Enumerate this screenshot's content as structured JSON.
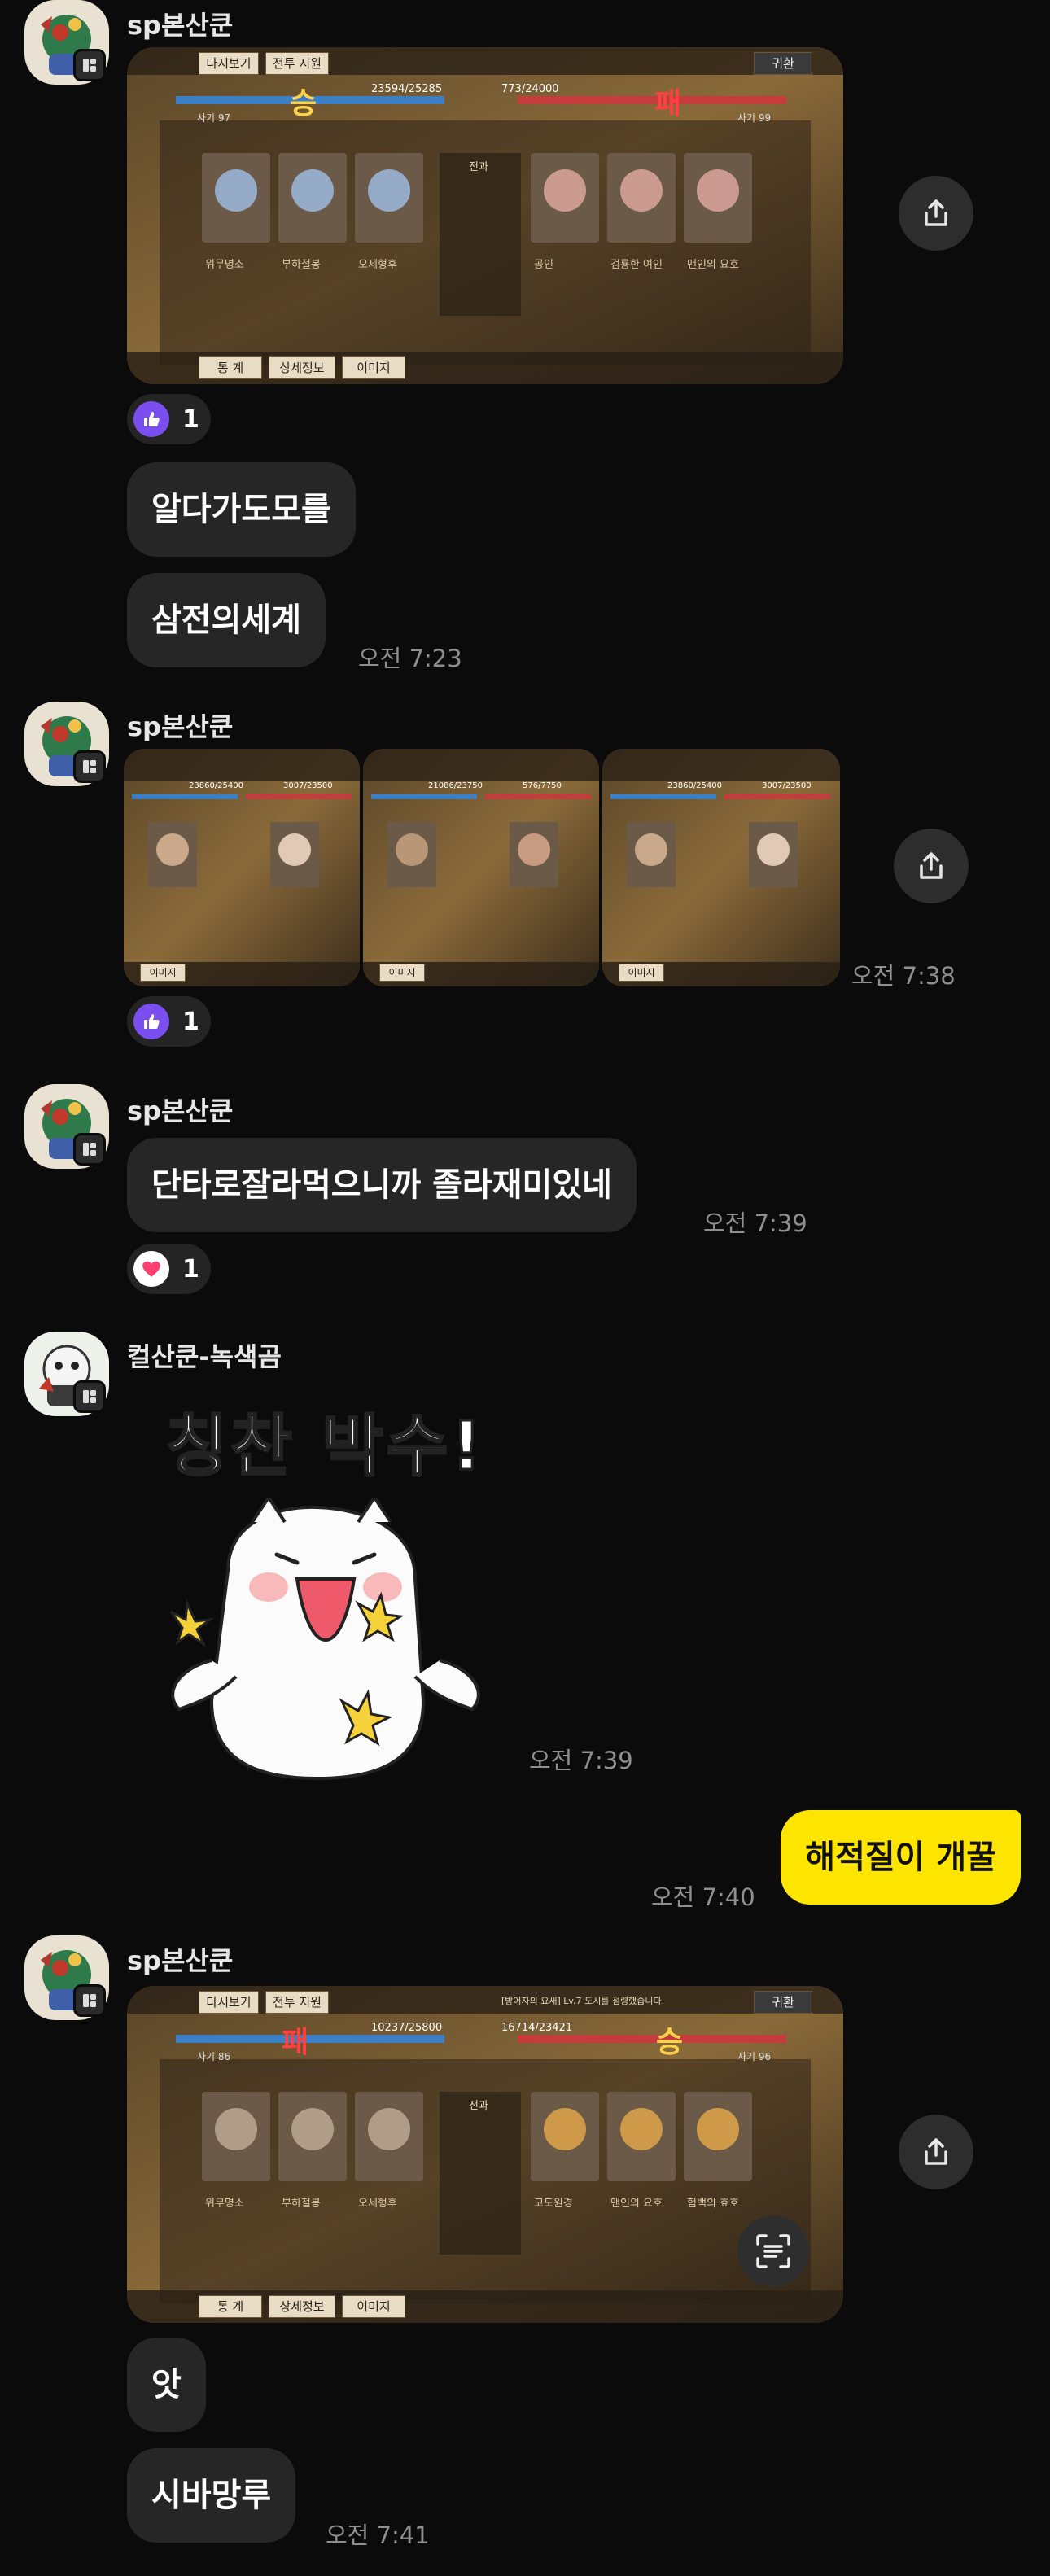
{
  "colors": {
    "bg": "#0b0b0b",
    "bubble": "#262626",
    "my_bubble": "#fee500",
    "like": "#7b4ef0",
    "heart": "#ff3f72"
  },
  "senders": {
    "sp": "sp본산쿤",
    "bear": "컬산쿤-녹색곰"
  },
  "msg1": {
    "game": {
      "btn_replay": "다시보기",
      "btn_info": "전투 지원",
      "btn_return": "귀환",
      "result_left": "승",
      "result_right": "패",
      "score_left": "23594/25285",
      "score_right": "773/24000",
      "morale_left": "사기 97",
      "morale_right": "사기 99",
      "center_title": "전과",
      "left_names": [
        "위무명소",
        "부하철봉",
        "오세형후"
      ],
      "right_names": [
        "공인",
        "검룡한 여인",
        "맨인의 요호"
      ],
      "bottom_btns": [
        "통 계",
        "상세정보",
        "이미지"
      ]
    },
    "reaction": {
      "icon": "thumbs-up",
      "count": "1"
    },
    "texts": [
      "알다가도모를",
      "삼전의세계"
    ],
    "time": "오전 7:23"
  },
  "msg2": {
    "tiles": [
      {
        "score_left": "23860/25400",
        "score_right": "3007/23500"
      },
      {
        "score_left": "21086/23750",
        "score_right": "576/7750"
      },
      {
        "score_left": "23860/25400",
        "score_right": "3007/23500"
      }
    ],
    "tile_btn": "이미지",
    "reaction": {
      "icon": "thumbs-up",
      "count": "1"
    },
    "time": "오전 7:38"
  },
  "msg3": {
    "text": "단타로잘라먹으니까 졸라재미있네",
    "time": "오전 7:39",
    "reaction": {
      "icon": "heart",
      "count": "1"
    }
  },
  "msg4": {
    "sticker_text": "칭찬 박수!",
    "time": "오전 7:39"
  },
  "msg5": {
    "text": "해적질이 개꿀",
    "time": "오전 7:40"
  },
  "msg6": {
    "game": {
      "btn_replay": "다시보기",
      "btn_info": "전투 지원",
      "btn_return": "귀환",
      "result_left": "패",
      "result_right": "승",
      "score_left": "10237/25800",
      "score_right": "16714/23421",
      "morale_left": "사기 86",
      "morale_right": "사기 96",
      "center_title": "전과",
      "left_names": [
        "위무명소",
        "부하철봉",
        "오세형후"
      ],
      "right_names": [
        "고도원경",
        "맨인의 요호",
        "험백의 효호"
      ],
      "bottom_btns": [
        "통 계",
        "상세정보",
        "이미지"
      ],
      "notice": "[방어자의 요새] Lv.7 도시를 점령했습니다."
    },
    "texts": [
      "앗",
      "시바망루"
    ],
    "time": "오전 7:41"
  }
}
